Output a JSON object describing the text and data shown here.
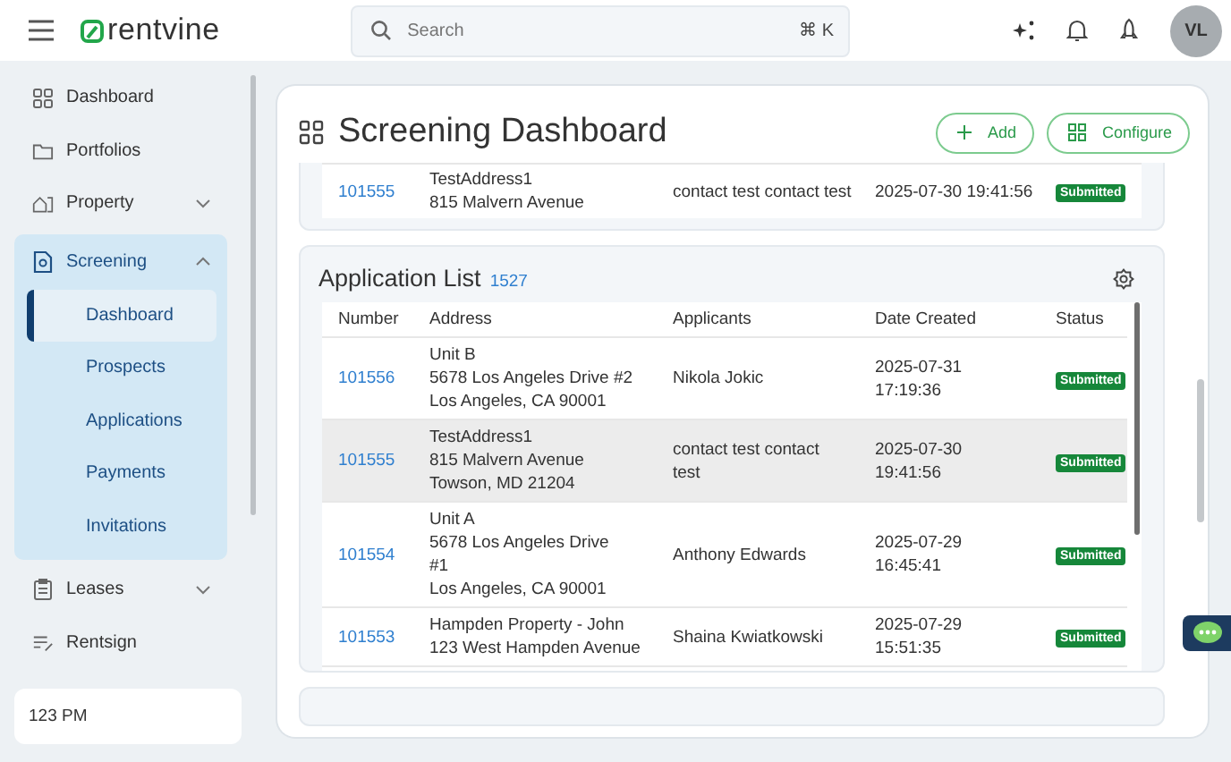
{
  "header": {
    "logo": "rentvine",
    "search": {
      "placeholder": "Search",
      "shortcut": "⌘ K"
    },
    "avatar": "VL"
  },
  "sidebar": {
    "items": [
      {
        "label": "Dashboard",
        "selected": false
      },
      {
        "label": "Portfolios",
        "selected": false
      },
      {
        "label": "Property",
        "selected": false,
        "expanded": false
      },
      {
        "label": "Screening",
        "selected": true,
        "expanded": true,
        "children": [
          {
            "label": "Dashboard",
            "selected": true
          },
          {
            "label": "Prospects",
            "selected": false
          },
          {
            "label": "Applications",
            "selected": false
          },
          {
            "label": "Payments",
            "selected": false
          },
          {
            "label": "Invitations",
            "selected": false
          }
        ]
      },
      {
        "label": "Leases",
        "selected": false,
        "expanded": false
      },
      {
        "label": "Rentsign",
        "selected": false
      }
    ],
    "footer": "123 PM"
  },
  "page": {
    "title": "Screening Dashboard",
    "buttons": [
      "Add",
      "Configure"
    ]
  },
  "top_panel": {
    "rows": [
      {
        "number": "101555",
        "address": [
          "TestAddress1",
          "815 Malvern Avenue"
        ],
        "applicants": "contact test contact test",
        "date_created": "2025-07-30 19:41:56",
        "status": "Submitted"
      }
    ]
  },
  "application_list": {
    "title": "Application List",
    "count": "1527",
    "columns": [
      "Number",
      "Address",
      "Applicants",
      "Date Created",
      "Status"
    ],
    "rows": [
      {
        "number": "101556",
        "address": [
          "Unit B",
          "5678 Los Angeles Drive #2",
          "Los Angeles, CA 90001"
        ],
        "applicants": "Nikola Jokic",
        "date_created": [
          "2025-07-31",
          "17:19:36"
        ],
        "status": "Submitted",
        "selected": false
      },
      {
        "number": "101555",
        "address": [
          "TestAddress1",
          "815 Malvern Avenue",
          "Towson, MD 21204"
        ],
        "applicants": "contact test contact test",
        "date_created": [
          "2025-07-30",
          "19:41:56"
        ],
        "status": "Submitted",
        "selected": true
      },
      {
        "number": "101554",
        "address": [
          "Unit A",
          "5678 Los Angeles Drive",
          "#1",
          "Los Angeles, CA 90001"
        ],
        "applicants": "Anthony Edwards",
        "date_created": [
          "2025-07-29",
          "16:45:41"
        ],
        "status": "Submitted",
        "selected": false
      },
      {
        "number": "101553",
        "address": [
          "Hampden Property - John",
          "123 West Hampden Avenue"
        ],
        "applicants": "Shaina Kwiatkowski",
        "date_created": [
          "2025-07-29",
          "15:51:35"
        ],
        "status": "Submitted",
        "selected": false
      }
    ]
  }
}
